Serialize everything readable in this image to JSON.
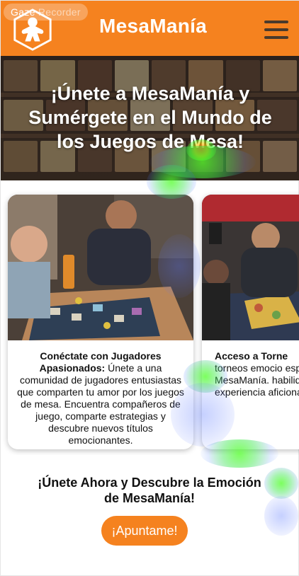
{
  "header": {
    "brand": "MesaManía",
    "gaze_label": "Gaze",
    "gaze_label_faded": "Recorder",
    "logo_icon": "meeple-logo-icon",
    "menu_icon": "hamburger-menu-icon",
    "background_color": "#f5821f"
  },
  "hero": {
    "title": "¡Únete a MesaManía y Sumérgete en el Mundo de los Juegos de Mesa!"
  },
  "cards": [
    {
      "heading": "Conéctate con Jugadores Apasionados:",
      "body": " Únete a una comunidad de jugadores entusiastas que comparten tu amor por los juegos de mesa. Encuentra compañeros de juego, comparte estrategias y descubre nuevos títulos emocionantes."
    },
    {
      "heading": "Acceso a Torne",
      "body": "torneos emocio especiales e MesaManía. habilidades, gana p una experiencia aficionados a lo"
    }
  ],
  "cta": {
    "title": "¡Únete Ahora y Descubre la Emoción de MesaManía!",
    "button_label": "¡Apuntame!",
    "accent": "#f5821f"
  }
}
